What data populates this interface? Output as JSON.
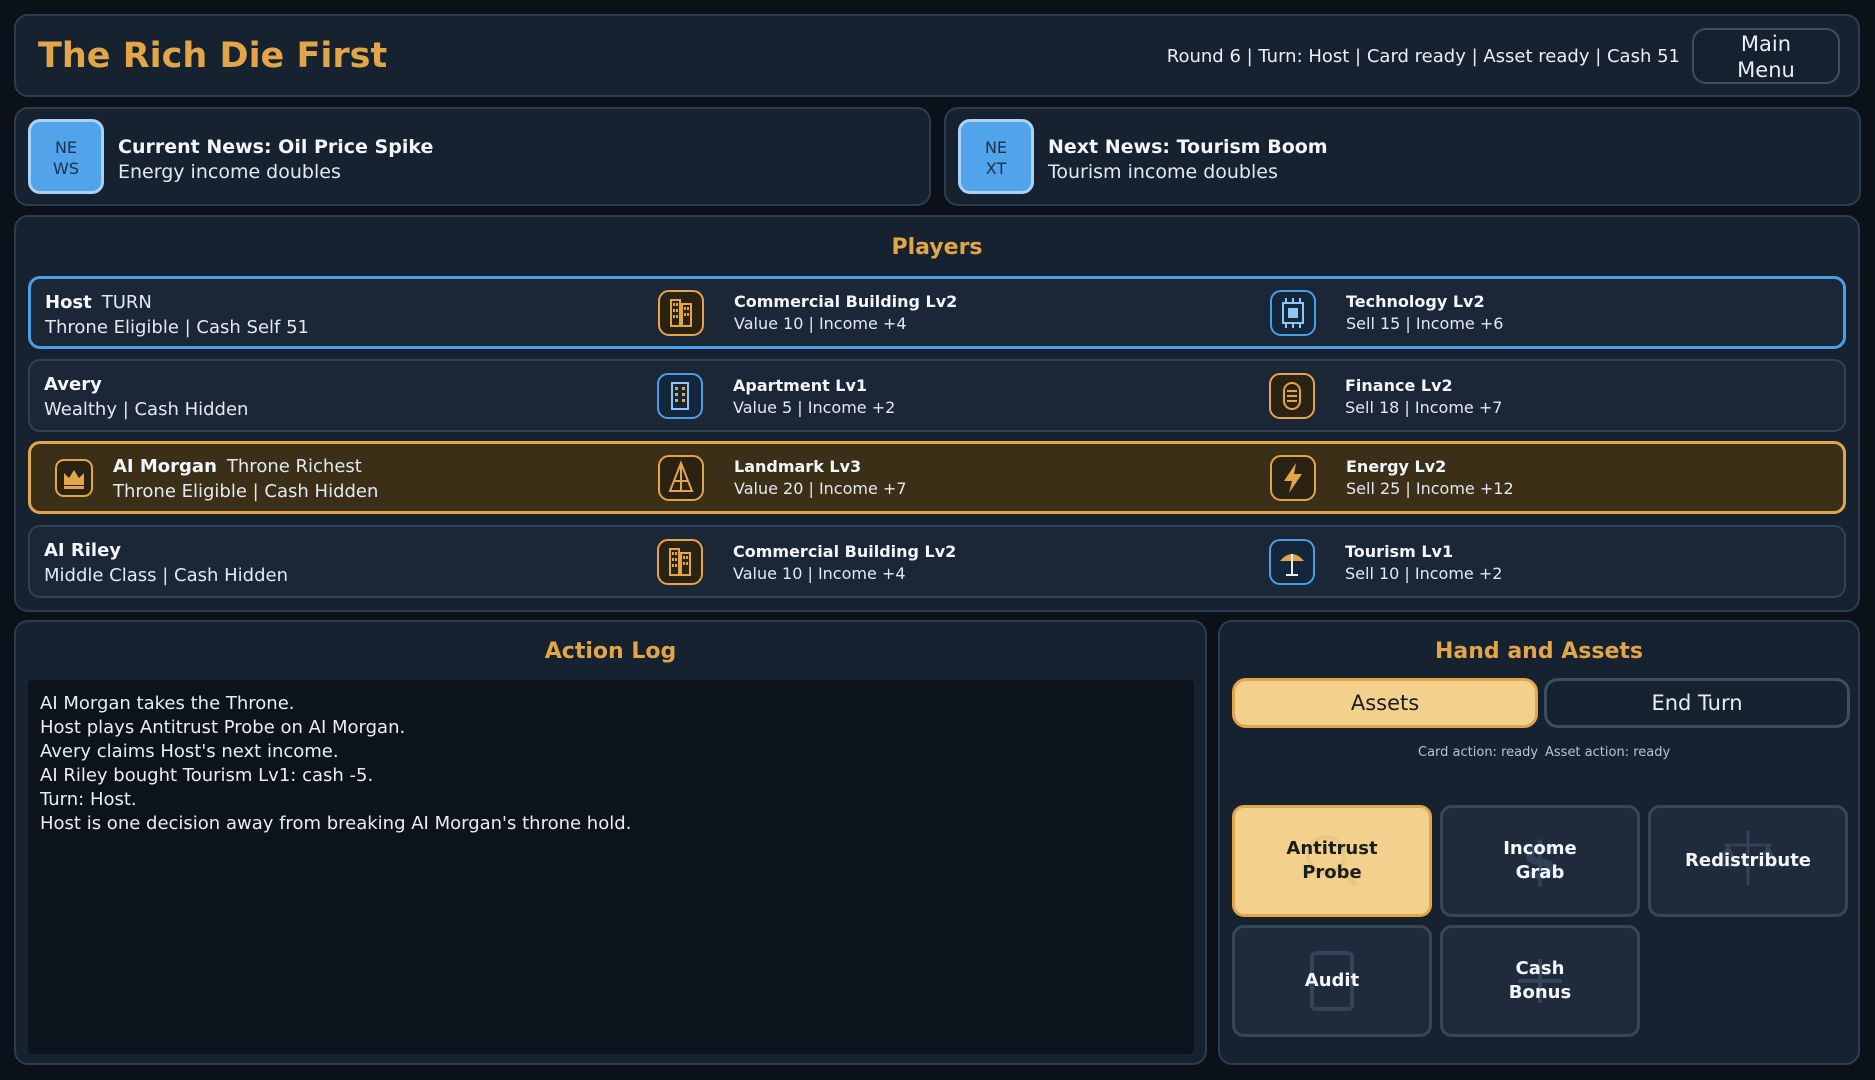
{
  "header": {
    "title": "The Rich Die First",
    "status": "Round 6 | Turn: Host | Card ready | Asset ready | Cash 51",
    "main_menu_line1": "Main",
    "main_menu_line2": "Menu"
  },
  "news": {
    "current": {
      "badge_line1": "NE",
      "badge_line2": "WS",
      "title": "Current News: Oil Price Spike",
      "desc": "Energy income doubles"
    },
    "next": {
      "badge_line1": "NE",
      "badge_line2": "XT",
      "title": "Next News: Tourism Boom",
      "desc": "Tourism income doubles"
    }
  },
  "players": {
    "title": "Players",
    "rows": [
      {
        "name": "Host",
        "tag": "TURN",
        "sub": "Throne Eligible | Cash Self 51",
        "asset1": {
          "icon": "commercial-building-icon",
          "name": "Commercial Building Lv2",
          "stats": "Value 10 | Income +4"
        },
        "asset2": {
          "icon": "technology-chip-icon",
          "name": "Technology Lv2",
          "stats": "Sell 15 | Income +6"
        }
      },
      {
        "name": "Avery",
        "tag": "",
        "sub": "Wealthy | Cash Hidden",
        "asset1": {
          "icon": "apartment-icon",
          "name": "Apartment Lv1",
          "stats": "Value 5 | Income +2"
        },
        "asset2": {
          "icon": "finance-coins-icon",
          "name": "Finance Lv2",
          "stats": "Sell 18 | Income +7"
        }
      },
      {
        "name": "AI Morgan",
        "tag": "Throne Richest",
        "sub": "Throne Eligible | Cash Hidden",
        "badge_icon": "crown-icon",
        "asset1": {
          "icon": "landmark-tower-icon",
          "name": "Landmark Lv3",
          "stats": "Value 20 | Income +7"
        },
        "asset2": {
          "icon": "energy-bolt-icon",
          "name": "Energy Lv2",
          "stats": "Sell 25 | Income +12"
        }
      },
      {
        "name": "AI Riley",
        "tag": "",
        "sub": "Middle Class | Cash Hidden",
        "asset1": {
          "icon": "commercial-building-icon",
          "name": "Commercial Building Lv2",
          "stats": "Value 10 | Income +4"
        },
        "asset2": {
          "icon": "tourism-umbrella-icon",
          "name": "Tourism Lv1",
          "stats": "Sell 10 | Income +2"
        }
      }
    ]
  },
  "action_log": {
    "title": "Action Log",
    "lines": [
      "AI Morgan takes the Throne.",
      "Host plays Antitrust Probe on AI Morgan.",
      "Avery claims Host's next income.",
      "AI Riley bought Tourism Lv1: cash -5.",
      "Turn: Host.",
      "Host is one decision away from breaking AI Morgan's throne hold."
    ]
  },
  "hand": {
    "title": "Hand and Assets",
    "assets_tab": "Assets",
    "end_turn": "End Turn",
    "card_action": "Card action: ready",
    "asset_action": "Asset action: ready",
    "cards": [
      {
        "line1": "Antitrust",
        "line2": "Probe",
        "icon": "magnifier-icon",
        "selected": true
      },
      {
        "line1": "Income",
        "line2": "Grab",
        "icon": "dollar-icon",
        "selected": false
      },
      {
        "line1": "Redistribute",
        "line2": "",
        "icon": "scales-icon",
        "selected": false
      },
      {
        "line1": "Audit",
        "line2": "",
        "icon": "document-icon",
        "selected": false
      },
      {
        "line1": "Cash",
        "line2": "Bonus",
        "icon": "plus-icon",
        "selected": false
      }
    ]
  },
  "colors": {
    "accent_gold": "#e2a548",
    "accent_blue": "#4a9ee6",
    "panel_bg": "#172231",
    "page_bg": "#0b1119"
  }
}
